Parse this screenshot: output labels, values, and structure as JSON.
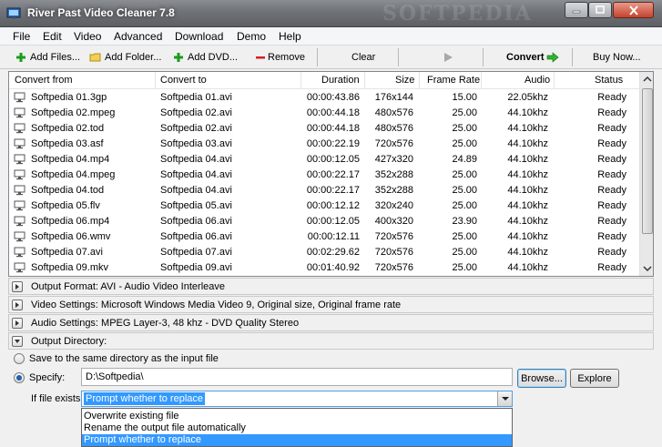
{
  "window": {
    "title": "River Past Video Cleaner 7.8",
    "watermark": "SOFTPEDIA"
  },
  "menu": [
    "File",
    "Edit",
    "Video",
    "Advanced",
    "Download",
    "Demo",
    "Help"
  ],
  "toolbar": {
    "add_files": "Add Files...",
    "add_folder": "Add Folder...",
    "add_dvd": "Add DVD...",
    "remove": "Remove",
    "clear": "Clear",
    "convert": "Convert",
    "buy_now": "Buy Now..."
  },
  "file_list": {
    "columns": [
      "Convert from",
      "Convert to",
      "Duration",
      "Size",
      "Frame Rate",
      "Audio",
      "Status"
    ],
    "rows": [
      [
        "Softpedia 01.3gp",
        "Softpedia 01.avi",
        "00:00:43.86",
        "176x144",
        "15.00",
        "22.05khz",
        "Ready"
      ],
      [
        "Softpedia 02.mpeg",
        "Softpedia 02.avi",
        "00:00:44.18",
        "480x576",
        "25.00",
        "44.10khz",
        "Ready"
      ],
      [
        "Softpedia 02.tod",
        "Softpedia 02.avi",
        "00:00:44.18",
        "480x576",
        "25.00",
        "44.10khz",
        "Ready"
      ],
      [
        "Softpedia 03.asf",
        "Softpedia 03.avi",
        "00:00:22.19",
        "720x576",
        "25.00",
        "44.10khz",
        "Ready"
      ],
      [
        "Softpedia 04.mp4",
        "Softpedia 04.avi",
        "00:00:12.05",
        "427x320",
        "24.89",
        "44.10khz",
        "Ready"
      ],
      [
        "Softpedia 04.mpeg",
        "Softpedia 04.avi",
        "00:00:22.17",
        "352x288",
        "25.00",
        "44.10khz",
        "Ready"
      ],
      [
        "Softpedia 04.tod",
        "Softpedia 04.avi",
        "00:00:22.17",
        "352x288",
        "25.00",
        "44.10khz",
        "Ready"
      ],
      [
        "Softpedia 05.flv",
        "Softpedia 05.avi",
        "00:00:12.12",
        "320x240",
        "25.00",
        "44.10khz",
        "Ready"
      ],
      [
        "Softpedia 06.mp4",
        "Softpedia 06.avi",
        "00:00:12.05",
        "400x320",
        "23.90",
        "44.10khz",
        "Ready"
      ],
      [
        "Softpedia 06.wmv",
        "Softpedia 06.avi",
        "00:00:12.11",
        "720x576",
        "25.00",
        "44.10khz",
        "Ready"
      ],
      [
        "Softpedia 07.avi",
        "Softpedia 07.avi",
        "00:02:29.62",
        "720x576",
        "25.00",
        "44.10khz",
        "Ready"
      ],
      [
        "Softpedia 09.mkv",
        "Softpedia 09.avi",
        "00:01:40.92",
        "720x576",
        "25.00",
        "44.10khz",
        "Ready"
      ]
    ]
  },
  "sections": {
    "output_format": "Output Format: AVI - Audio Video Interleave",
    "video_settings": "Video Settings: Microsoft Windows Media Video 9, Original size, Original frame rate",
    "audio_settings": "Audio Settings: MPEG Layer-3, 48 khz - DVD Quality Stereo",
    "output_directory": "Output Directory:"
  },
  "output_dir": {
    "save_same": "Save to the same directory as the input file",
    "specify": "Specify:",
    "path": "D:\\Softpedia\\",
    "browse": "Browse...",
    "explore": "Explore",
    "if_exists_label": "If file exists:",
    "if_exists_value": "Prompt whether to replace",
    "options": [
      "Overwrite existing file",
      "Rename the output file automatically",
      "Prompt whether to replace"
    ]
  }
}
